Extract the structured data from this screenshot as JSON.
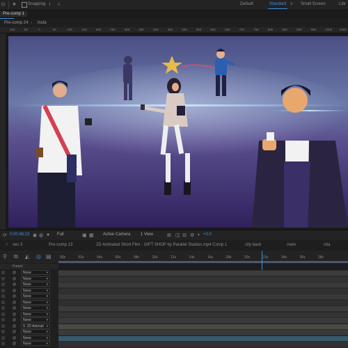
{
  "topbar": {
    "snapping_label": "Snapping",
    "workspaces": [
      "Default",
      "Standard",
      "Small Screen",
      "Libr"
    ],
    "active_workspace": "Standard"
  },
  "comp_panel": {
    "tab_label": "Pre-comp 1"
  },
  "breadcrumb": [
    "Pre-comp 24",
    "insta"
  ],
  "viewer_ruler_ticks": [
    "100",
    "50",
    "0",
    "50",
    "100",
    "150",
    "200",
    "250",
    "300",
    "350",
    "400",
    "450",
    "500",
    "550",
    "600",
    "650",
    "700",
    "750",
    "800",
    "850",
    "900",
    "950",
    "1000",
    "1050"
  ],
  "viewer_toolbar": {
    "timecode": "0;00;48;23",
    "resolution": "Full",
    "camera": "Active Camera",
    "views": "1 View",
    "exposure": "+0.0"
  },
  "timeline_tabs": [
    "sec 3",
    "Pre-comp 13",
    "2D Animated Short Film - GIFT SHOP by Parallel Studios.mp4 Comp 1",
    "city back",
    "main",
    "cita"
  ],
  "time_ruler_ticks": [
    "00s",
    "02s",
    "04s",
    "06s",
    "08s",
    "10s",
    "12s",
    "14s",
    "16s",
    "18s",
    "20s",
    "22s",
    "24s",
    "26s",
    "28s"
  ],
  "layer_header": "Parent",
  "layers": [
    {
      "parent": "None"
    },
    {
      "parent": "None"
    },
    {
      "parent": "None"
    },
    {
      "parent": "None"
    },
    {
      "parent": "None"
    },
    {
      "parent": "None"
    },
    {
      "parent": "None"
    },
    {
      "parent": "None"
    },
    {
      "parent": "None"
    },
    {
      "parent": "9. 2D Animati"
    },
    {
      "parent": "None"
    },
    {
      "parent": "None"
    },
    {
      "parent": "None"
    }
  ],
  "colors": {
    "accent": "#3d8ee6",
    "scene_sky_top": "#5b6fa3",
    "scene_floor": "#3a2a6b"
  }
}
